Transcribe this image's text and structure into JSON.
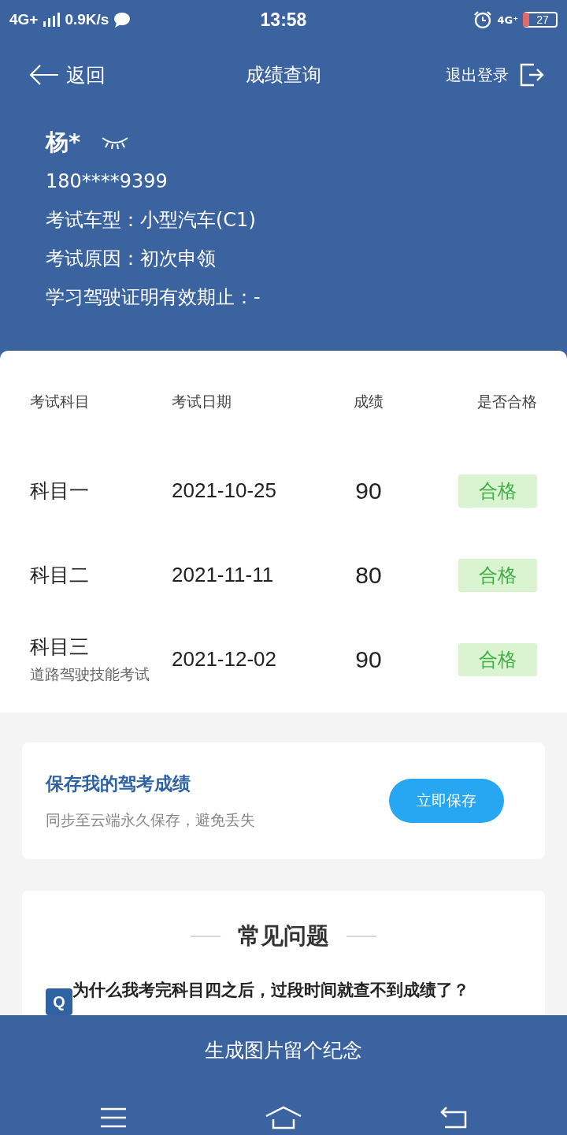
{
  "status_bar": {
    "network": "4G+",
    "speed": "0.9K/s",
    "time": "13:58",
    "network_right": "4G⁺",
    "battery": "27"
  },
  "header": {
    "back": "返回",
    "title": "成绩查询",
    "logout": "退出登录"
  },
  "profile": {
    "name": "杨*",
    "phone": "180****9399",
    "lines": [
      "考试车型：小型汽车(C1)",
      "考试原因：初次申领",
      "学习驾驶证明有效期止：-"
    ]
  },
  "table": {
    "columns": [
      "考试科目",
      "考试日期",
      "成绩",
      "是否合格"
    ],
    "rows": [
      {
        "subject": "科目一",
        "note": "",
        "date": "2021-10-25",
        "score": "90",
        "result": "合格",
        "passed": true
      },
      {
        "subject": "科目二",
        "note": "",
        "date": "2021-11-11",
        "score": "80",
        "result": "合格",
        "passed": true
      },
      {
        "subject": "科目三",
        "note": "道路驾驶技能考试",
        "date": "2021-12-02",
        "score": "90",
        "result": "合格",
        "passed": true
      }
    ]
  },
  "save_card": {
    "title": "保存我的驾考成绩",
    "subtitle": "同步至云端永久保存，避免丢失",
    "button": "立即保存"
  },
  "faq": {
    "title": "常见问题",
    "badge": "Q",
    "questions": [
      "为什么我考完科目四之后，过段时间就查不到成绩了？"
    ]
  },
  "bottom_button": "生成图片留个纪念"
}
